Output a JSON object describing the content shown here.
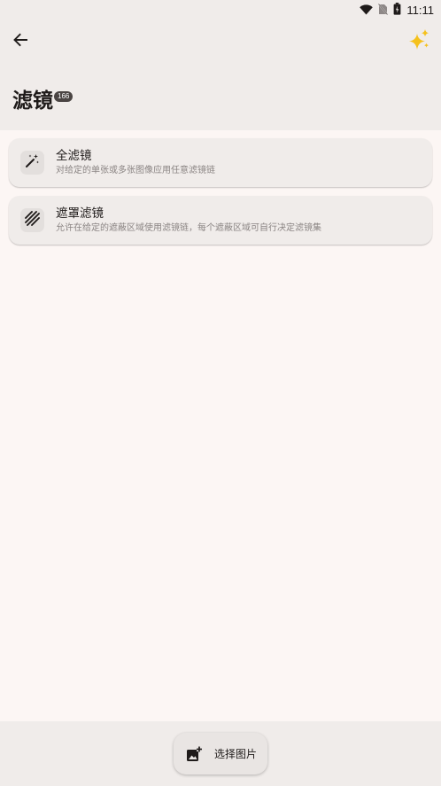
{
  "status_bar": {
    "time": "11:11",
    "icons": [
      "wifi-icon",
      "no-sim-icon",
      "battery-icon"
    ]
  },
  "app_bar": {
    "back_icon": "arrow-left-icon",
    "action_icon": "sparkles-icon",
    "title": "滤镜",
    "count_badge": "166"
  },
  "cards": [
    {
      "icon": "magic-wand-icon",
      "title": "全滤镜",
      "subtitle": "对给定的单张或多张图像应用任意滤镜链"
    },
    {
      "icon": "mask-stripes-icon",
      "title": "遮罩滤镜",
      "subtitle": "允许在给定的遮蔽区域使用滤镜链，每个遮蔽区域可自行决定滤镜集"
    }
  ],
  "fab": {
    "icon": "add-image-icon",
    "label": "选择图片"
  },
  "colors": {
    "background": "#fcf6f4",
    "surface": "#f0ecea",
    "badge": "#4a4443",
    "sparkle": "#f5c11c"
  }
}
